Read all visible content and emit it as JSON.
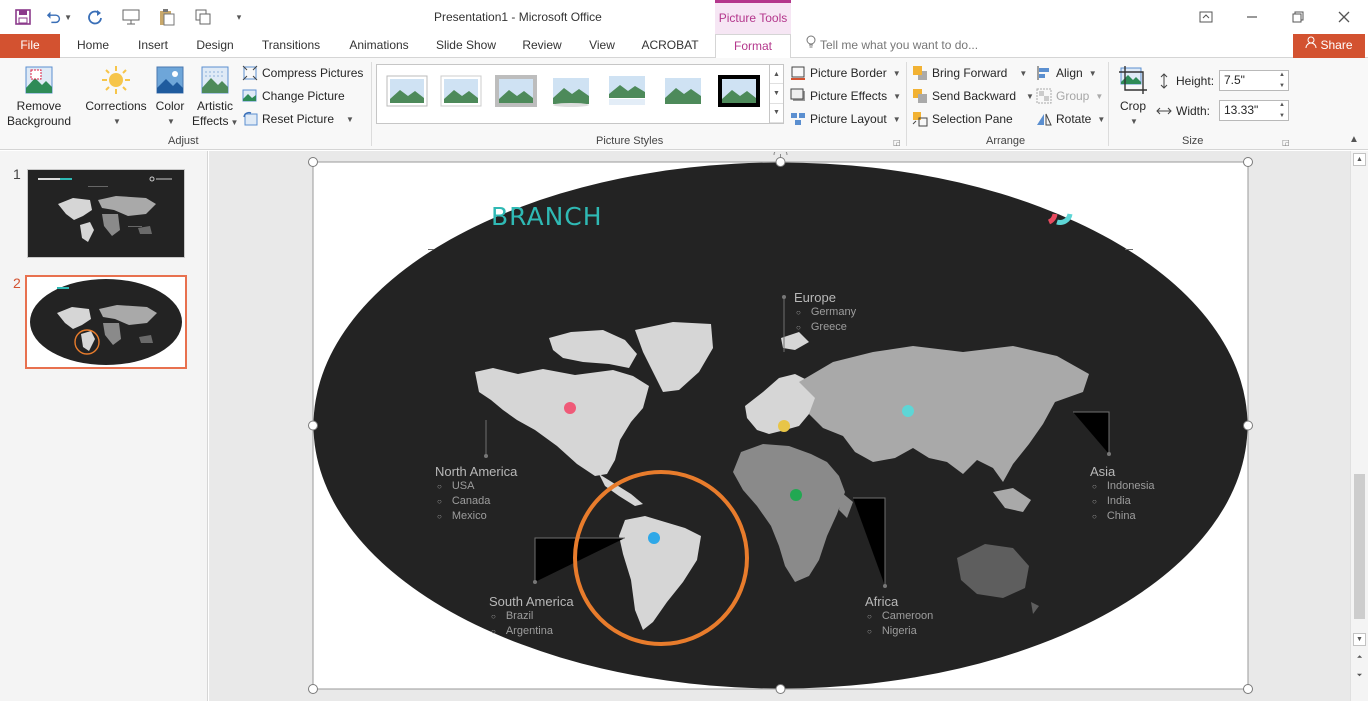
{
  "window": {
    "title": "Presentation1 - Microsoft Office",
    "contextual_tab": "Picture Tools"
  },
  "tabs": {
    "file": "File",
    "home": "Home",
    "insert": "Insert",
    "design": "Design",
    "transitions": "Transitions",
    "animations": "Animations",
    "slide_show": "Slide Show",
    "review": "Review",
    "view": "View",
    "acrobat": "ACROBAT",
    "format": "Format"
  },
  "tell_me": "Tell me what you want to do...",
  "share": "Share",
  "ribbon": {
    "remove_background_1": "Remove",
    "remove_background_2": "Background",
    "corrections": "Corrections",
    "color": "Color",
    "artistic_1": "Artistic",
    "artistic_2": "Effects",
    "compress": "Compress Pictures",
    "change": "Change Picture",
    "reset": "Reset Picture",
    "adjust_label": "Adjust",
    "picture_styles_label": "Picture Styles",
    "picture_border": "Picture Border",
    "picture_effects": "Picture Effects",
    "picture_layout": "Picture Layout",
    "bring_forward": "Bring Forward",
    "send_backward": "Send Backward",
    "selection_pane": "Selection Pane",
    "align": "Align",
    "group": "Group",
    "rotate": "Rotate",
    "arrange_label": "Arrange",
    "crop": "Crop",
    "height_label": "Height:",
    "height_value": "7.5\"",
    "width_label": "Width:",
    "width_value": "13.33\"",
    "size_label": "Size"
  },
  "slides": {
    "n1": "1",
    "n2": "2"
  },
  "slide": {
    "brand": "BRANCH",
    "regions": {
      "europe": {
        "name": "Europe",
        "items": [
          "Germany",
          "Greece"
        ]
      },
      "north_america": {
        "name": "North America",
        "items": [
          "USA",
          "Canada",
          "Mexico"
        ]
      },
      "asia": {
        "name": "Asia",
        "items": [
          "Indonesia",
          "India",
          "China"
        ]
      },
      "south_america": {
        "name": "South America",
        "items": [
          "Brazil",
          "Argentina"
        ]
      },
      "africa": {
        "name": "Africa",
        "items": [
          "Cameroon",
          "Nigeria"
        ]
      }
    },
    "dot_colors": {
      "north_america": "#ef5a78",
      "europe": "#e8c547",
      "asia": "#5ed6d6",
      "africa": "#22a852",
      "south_america": "#2fa8e8"
    },
    "highlight_color": "#e87c2c",
    "brand_color": "#2fb9b4"
  },
  "colors": {
    "accent": "#d35230",
    "picture_tools": "#b4378c"
  }
}
